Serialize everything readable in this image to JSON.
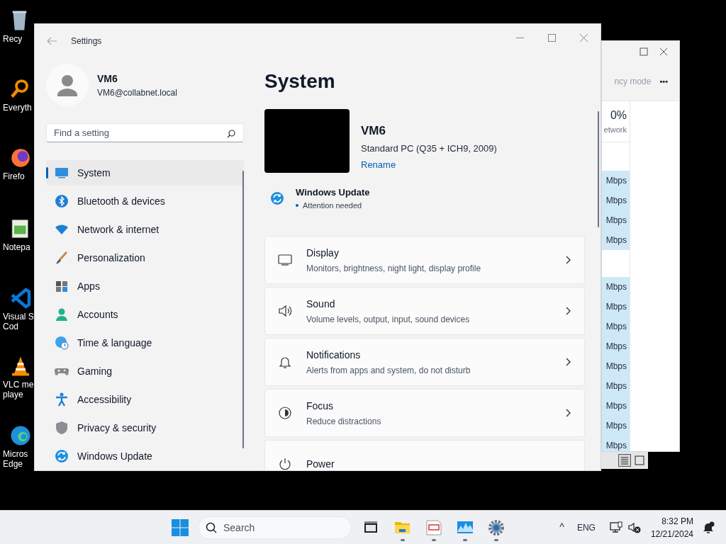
{
  "desktop_icons": [
    {
      "kind": "recycle",
      "label_lines": [
        "Recy"
      ]
    },
    {
      "kind": "magnifier",
      "label_lines": [
        "Everyth"
      ]
    },
    {
      "kind": "fox",
      "label_lines": [
        "Firefo"
      ]
    },
    {
      "kind": "notepad",
      "label_lines": [
        "Notepa"
      ]
    },
    {
      "kind": "code",
      "label_lines": [
        "Visual S",
        "Cod"
      ]
    },
    {
      "kind": "cone",
      "label_lines": [
        "VLC me",
        "playe"
      ]
    },
    {
      "kind": "swirl",
      "label_lines": [
        "Micros",
        "Edge"
      ]
    }
  ],
  "background_window": {
    "header_text": "ncy mode",
    "more": "•••",
    "percent": "0%",
    "column_label": "etwork",
    "row_groups": [
      [
        "Mbps",
        "Mbps",
        "Mbps",
        "Mbps"
      ],
      [
        "Mbps",
        "Mbps",
        "Mbps",
        "Mbps",
        "Mbps",
        "Mbps",
        "Mbps",
        "Mbps",
        "Mbps"
      ]
    ]
  },
  "window": {
    "title": "Settings"
  },
  "profile": {
    "name": "VM6",
    "email": "VM6@collabnet.local"
  },
  "search": {
    "placeholder": "Find a setting"
  },
  "nav_items": [
    {
      "label": "System",
      "kind": "system",
      "selected": true
    },
    {
      "label": "Bluetooth & devices",
      "kind": "bluetooth",
      "selected": false
    },
    {
      "label": "Network & internet",
      "kind": "wifi",
      "selected": false
    },
    {
      "label": "Personalization",
      "kind": "brush",
      "selected": false
    },
    {
      "label": "Apps",
      "kind": "apps",
      "selected": false
    },
    {
      "label": "Accounts",
      "kind": "person",
      "selected": false
    },
    {
      "label": "Time & language",
      "kind": "globe",
      "selected": false
    },
    {
      "label": "Gaming",
      "kind": "gamepad",
      "selected": false
    },
    {
      "label": "Accessibility",
      "kind": "accessibility",
      "selected": false
    },
    {
      "label": "Privacy & security",
      "kind": "shield",
      "selected": false
    },
    {
      "label": "Windows Update",
      "kind": "update",
      "selected": false
    }
  ],
  "page_title": "System",
  "device": {
    "name": "VM6",
    "model": "Standard PC (Q35 + ICH9, 2009)",
    "rename": "Rename"
  },
  "update": {
    "title": "Windows Update",
    "status": "Attention needed"
  },
  "cards": [
    {
      "kind": "display",
      "title": "Display",
      "subtitle": "Monitors, brightness, night light, display profile"
    },
    {
      "kind": "sound",
      "title": "Sound",
      "subtitle": "Volume levels, output, input, sound devices"
    },
    {
      "kind": "bell",
      "title": "Notifications",
      "subtitle": "Alerts from apps and system, do not disturb"
    },
    {
      "kind": "focus",
      "title": "Focus",
      "subtitle": "Reduce distractions"
    },
    {
      "kind": "power",
      "title": "Power"
    }
  ],
  "taskbar": {
    "search_placeholder": "Search",
    "apps": [
      {
        "kind": "terminal",
        "running": false
      },
      {
        "kind": "folder",
        "running": true
      },
      {
        "kind": "editor",
        "running": true
      },
      {
        "kind": "monitor",
        "running": true
      },
      {
        "kind": "gear",
        "running": true
      }
    ],
    "tray_chevron": "^",
    "language": "ENG",
    "time": "8:32 PM",
    "date": "12/21/2024"
  }
}
